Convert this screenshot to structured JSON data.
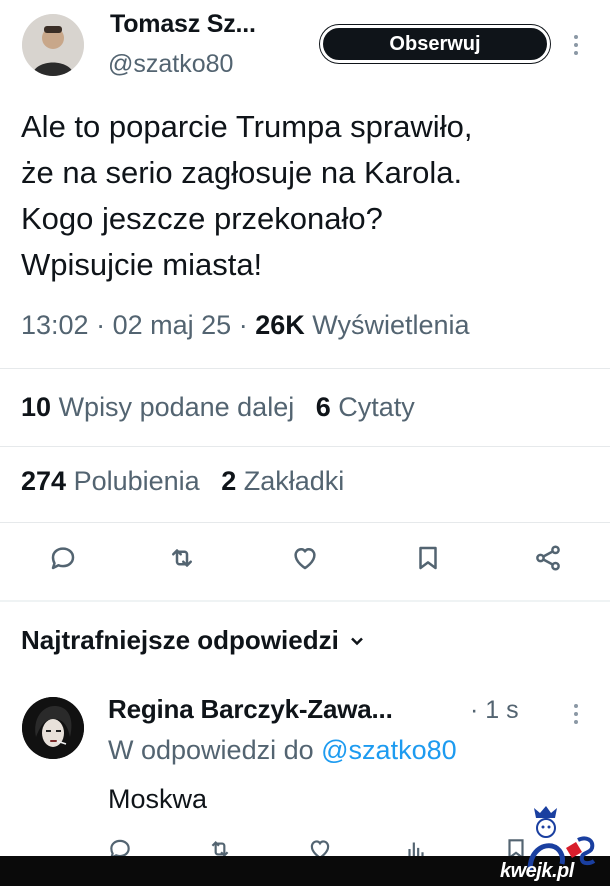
{
  "author": {
    "name": "Tomasz Sz...",
    "handle": "@szatko80",
    "follow_label": "Obserwuj"
  },
  "tweet": {
    "lines": [
      "Ale to poparcie Trumpa sprawiło,",
      "że na serio zagłosuje na Karola.",
      "Kogo jeszcze przekonało?",
      "Wpisujcie miasta!"
    ],
    "time": "13:02",
    "date": "02 maj 25",
    "views_count": "26K",
    "views_label": "Wyświetlenia",
    "separator": "·"
  },
  "stats": {
    "reposts_count": "10",
    "reposts_label": "Wpisy podane dalej",
    "quotes_count": "6",
    "quotes_label": "Cytaty",
    "likes_count": "274",
    "likes_label": "Polubienia",
    "bookmarks_count": "2",
    "bookmarks_label": "Zakładki"
  },
  "actions": [
    "reply-icon",
    "repost-icon",
    "like-icon",
    "bookmark-icon",
    "share-icon"
  ],
  "replies_section": {
    "sort_label": "Najtrafniejsze odpowiedzi"
  },
  "reply": {
    "name": "Regina Barczyk-Zawa...",
    "time": "· 1 s",
    "context_prefix": "W odpowiedzi do",
    "context_mention": "@szatko80",
    "text": "Moskwa"
  },
  "watermark": {
    "text": "kwejk.pl"
  },
  "colors": {
    "text_primary": "#0f1419",
    "text_secondary": "#536471",
    "accent": "#1d9bf0",
    "follow_bg": "#0f1419"
  }
}
